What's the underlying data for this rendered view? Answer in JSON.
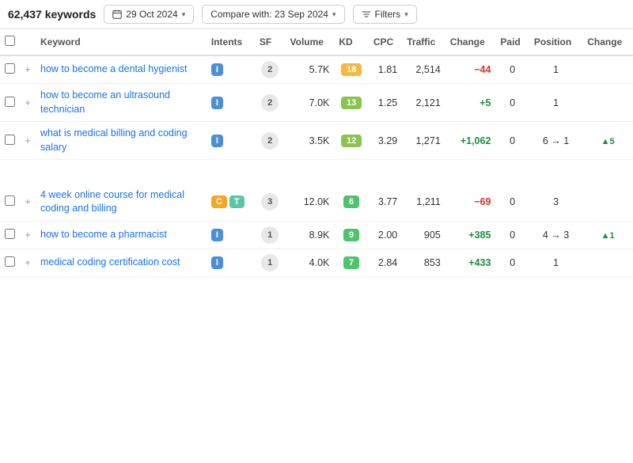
{
  "toolbar": {
    "keyword_count": "62,437 keywords",
    "date_label": "29 Oct 2024",
    "compare_label": "Compare with: 23 Sep 2024",
    "filters_label": "Filters"
  },
  "table": {
    "headers": [
      "",
      "",
      "Keyword",
      "Intents",
      "SF",
      "Volume",
      "KD",
      "CPC",
      "Traffic",
      "Change",
      "Paid",
      "Position",
      "Change"
    ],
    "rows": [
      {
        "keyword": "how to become a dental hygienist",
        "intents": [
          "I"
        ],
        "intent_colors": [
          "blue"
        ],
        "sf": "2",
        "volume": "5.7K",
        "kd": "18",
        "kd_class": "kd-18",
        "cpc": "1.81",
        "traffic": "2,514",
        "change": "−44",
        "change_type": "neg",
        "paid": "0",
        "position": "1",
        "pos_change": "",
        "pos_change_type": ""
      },
      {
        "keyword": "how to become an ultrasound technician",
        "intents": [
          "I"
        ],
        "intent_colors": [
          "blue"
        ],
        "sf": "2",
        "volume": "7.0K",
        "kd": "13",
        "kd_class": "kd-13",
        "cpc": "1.25",
        "traffic": "2,121",
        "change": "+5",
        "change_type": "pos",
        "paid": "0",
        "position": "1",
        "pos_change": "",
        "pos_change_type": ""
      },
      {
        "keyword": "what is medical billing and coding salary",
        "intents": [
          "I"
        ],
        "intent_colors": [
          "blue"
        ],
        "sf": "2",
        "volume": "3.5K",
        "kd": "12",
        "kd_class": "kd-12",
        "cpc": "3.29",
        "traffic": "1,271",
        "change": "+1,062",
        "change_type": "pos",
        "paid": "0",
        "position": "6 → 1",
        "pos_change": "▲5",
        "pos_change_type": "pos"
      },
      {
        "keyword": "4 week online course for medical coding and billing",
        "intents": [
          "C",
          "T"
        ],
        "intent_colors": [
          "yellow",
          "teal"
        ],
        "sf": "3",
        "volume": "12.0K",
        "kd": "6",
        "kd_class": "kd-6",
        "cpc": "3.77",
        "traffic": "1,211",
        "change": "−69",
        "change_type": "neg",
        "paid": "0",
        "position": "3",
        "pos_change": "",
        "pos_change_type": ""
      },
      {
        "keyword": "how to become a pharmacist",
        "intents": [
          "I"
        ],
        "intent_colors": [
          "blue"
        ],
        "sf": "1",
        "volume": "8.9K",
        "kd": "9",
        "kd_class": "kd-9",
        "cpc": "2.00",
        "traffic": "905",
        "change": "+385",
        "change_type": "pos",
        "paid": "0",
        "position": "4 → 3",
        "pos_change": "▲1",
        "pos_change_type": "pos"
      },
      {
        "keyword": "medical coding certification cost",
        "intents": [
          "I"
        ],
        "intent_colors": [
          "blue"
        ],
        "sf": "1",
        "volume": "4.0K",
        "kd": "7",
        "kd_class": "kd-7",
        "cpc": "2.84",
        "traffic": "853",
        "change": "+433",
        "change_type": "pos",
        "paid": "0",
        "position": "1",
        "pos_change": "",
        "pos_change_type": ""
      }
    ]
  }
}
